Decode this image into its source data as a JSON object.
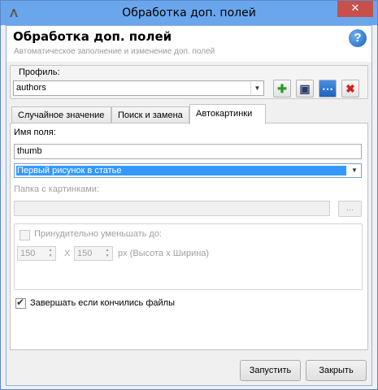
{
  "window": {
    "title": "Обработка доп. полей",
    "close_glyph": "✕"
  },
  "header": {
    "title": "Обработка доп. полей",
    "subtitle": "Автоматическое заполнение и изменение доп. полей",
    "help_glyph": "?"
  },
  "profile": {
    "label": "Профиль:",
    "value": "authors",
    "buttons": [
      {
        "icon": "plus-icon",
        "glyph": "✚",
        "color": "#2d9a2d"
      },
      {
        "icon": "save-icon",
        "glyph": "▣",
        "color": "#2b3e6a"
      },
      {
        "icon": "more-icon",
        "glyph": "⋯",
        "color": "#ffffff"
      },
      {
        "icon": "delete-icon",
        "glyph": "✖",
        "color": "#d22020"
      }
    ]
  },
  "tabs": [
    {
      "label": "Случайное значение",
      "active": false
    },
    {
      "label": "Поиск и замена",
      "active": false
    },
    {
      "label": "Автокартинки",
      "active": true
    }
  ],
  "panel": {
    "field_name_label": "Имя поля:",
    "field_name_value": "thumb",
    "mode_value": "Первый рисунок в статье",
    "folder_label": "Папка с картинками:",
    "folder_value": "",
    "browse_label": "...",
    "reduce_label": "Принудительно уменьшать до:",
    "reduce_checked": false,
    "height_value": "150",
    "x_label": "X",
    "width_value": "150",
    "size_hint": "px (Высота x Ширина)",
    "stop_label": "Завершать если кончились файлы",
    "stop_checked": true
  },
  "footer": {
    "run_label": "Запустить",
    "close_label": "Закрыть"
  },
  "colors": {
    "titlebar": "#6aa6ec",
    "close": "#c7504b",
    "selection": "#3399ff"
  }
}
